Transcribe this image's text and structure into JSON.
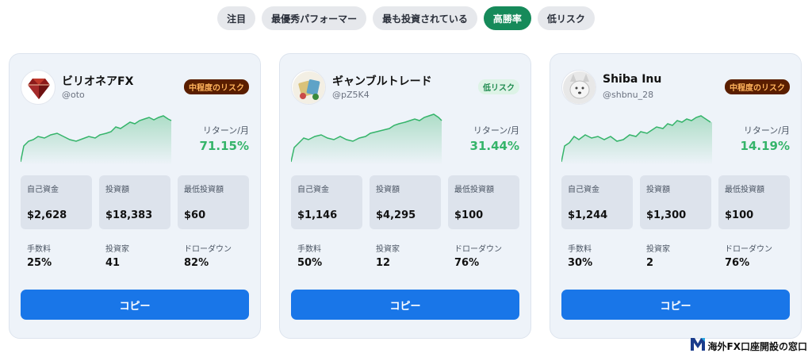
{
  "tabs": [
    {
      "label": "注目",
      "active": false
    },
    {
      "label": "最優秀パフォーマー",
      "active": false
    },
    {
      "label": "最も投資されている",
      "active": false
    },
    {
      "label": "高勝率",
      "active": true
    },
    {
      "label": "低リスク",
      "active": false
    }
  ],
  "labels": {
    "return": "リターン/月",
    "own_funds": "自己資金",
    "invested": "投資額",
    "min_invest": "最低投資額",
    "fee": "手数料",
    "investors": "投資家",
    "drawdown": "ドローダウン",
    "copy": "コピー"
  },
  "cards": [
    {
      "name": "ビリオネアFX",
      "handle": "@oto",
      "risk": "中程度のリスク",
      "risk_level": "mid",
      "avatar_icon": "diamond-icon",
      "return_pct": "71.15%",
      "own_funds": "$2,628",
      "invested": "$18,383",
      "min_invest": "$60",
      "fee": "25%",
      "investors": "41",
      "drawdown": "82%"
    },
    {
      "name": "ギャンブルトレード",
      "handle": "@pZ5K4",
      "risk": "低リスク",
      "risk_level": "low",
      "avatar_icon": "gambler-icon",
      "return_pct": "31.44%",
      "own_funds": "$1,146",
      "invested": "$4,295",
      "min_invest": "$100",
      "fee": "50%",
      "investors": "12",
      "drawdown": "76%"
    },
    {
      "name": "Shiba Inu",
      "handle": "@shbnu_28",
      "risk": "中程度のリスク",
      "risk_level": "mid",
      "avatar_icon": "shiba-dog-icon",
      "return_pct": "14.19%",
      "own_funds": "$1,244",
      "invested": "$1,300",
      "min_invest": "$100",
      "fee": "30%",
      "investors": "2",
      "drawdown": "76%"
    }
  ],
  "brand": {
    "text": "海外FX口座開設の窓口",
    "logo_icon": "m-logo-icon"
  },
  "colors": {
    "accent_green": "#168a5a",
    "return_green": "#35b46a",
    "copy_blue": "#1976e8",
    "risk_mid_bg": "#5a1e00",
    "risk_mid_fg": "#ffb35c",
    "risk_low_bg": "#ddf3e6",
    "risk_low_fg": "#1f8a4f"
  }
}
